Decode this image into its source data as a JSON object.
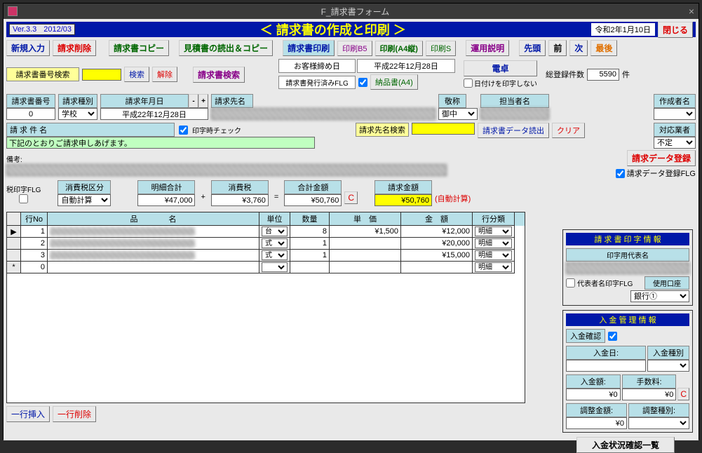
{
  "win": {
    "title": "F_請求書フォーム",
    "ver": "Ver.3.3",
    "verdate": "2012/03",
    "headerTitle": "＜ 請求書の作成と印刷 ＞",
    "today": "令和2年1月10日",
    "close": "閉じる"
  },
  "tb1": {
    "new": "新規入力",
    "del": "請求削除",
    "copy": "請求書コピー",
    "readest": "見積書の読出＆コピー",
    "print": "請求書印刷",
    "b5": "印刷B5",
    "a4p": "印刷(A4縦)",
    "s": "印刷S",
    "help": "運用説明",
    "first": "先頭",
    "prev": "前",
    "next": "次",
    "last": "最後"
  },
  "tb2": {
    "searchlbl": "請求書番号検索",
    "searchbtn": "検索",
    "clr": "解除",
    "invsearch": "請求書検索",
    "duelbl": "お客様締め日",
    "dueval": "平成22年12月28日",
    "issuedlbl": "請求書発行済みFLG",
    "delivbtn": "納品書(A4)",
    "calc": "電卓",
    "totallbl": "総登録件数",
    "totalval": "5590",
    "unit": "件",
    "noprintdate": "日付けを印字しない"
  },
  "inv": {
    "nolbl": "請求書番号",
    "no": "0",
    "typelbl": "請求種別",
    "type": "学校",
    "datelbl": "請求年月日",
    "date": "平成22年12月28日",
    "addrlbl": "請求先名",
    "honlbl": "敬称",
    "hon": "御中",
    "piclbl": "担当者名",
    "authorlbl": "作成者名"
  },
  "subj": {
    "lbl": "請 求 件 名",
    "body": "下記のとおりご請求申しあげます。",
    "chkprint": "印字時チェック",
    "addrsearch": "請求先名検索",
    "dataout": "請求書データ読出",
    "clear": "クリア",
    "vendorlbl": "対応業者",
    "vendor": "不定"
  },
  "remark": {
    "lbl": "備考:"
  },
  "reg": {
    "btn": "請求データ登録",
    "flg": "請求データ登録FLG"
  },
  "sums": {
    "taxflg": "税印字FLG",
    "taxcls": "消費税区分",
    "taxclsval": "自動計算",
    "subtotallbl": "明細合計",
    "subtotal": "¥47,000",
    "taxlbl": "消費税",
    "tax": "¥3,760",
    "totallbl": "合計金額",
    "total": "¥50,760",
    "billlbl": "請求金額",
    "bill": "¥50,760",
    "auto": "(自動計算)",
    "cbtn": "C"
  },
  "cols": {
    "no": "行No",
    "name": "品　　　　名",
    "unit": "単位",
    "qty": "数量",
    "price": "単　価",
    "amt": "金　額",
    "cat": "行分類"
  },
  "rows": [
    {
      "no": "1",
      "unit": "台",
      "qty": "8",
      "price": "¥1,500",
      "amt": "¥12,000",
      "cat": "明細"
    },
    {
      "no": "2",
      "unit": "式",
      "qty": "1",
      "price": "",
      "amt": "¥20,000",
      "cat": "明細"
    },
    {
      "no": "3",
      "unit": "式",
      "qty": "1",
      "price": "",
      "amt": "¥15,000",
      "cat": "明細"
    },
    {
      "no": "0",
      "unit": "",
      "qty": "",
      "price": "",
      "amt": "",
      "cat": "明細"
    }
  ],
  "bottom": {
    "ins": "一行挿入",
    "del": "一行削除"
  },
  "printinfo": {
    "head": "請 求 書 印 字 情 報",
    "replbl": "印字用代表名",
    "repcb": "代表者名印字FLG",
    "acctlbl": "使用口座",
    "acct": "銀行①"
  },
  "payinfo": {
    "head": "入 金 管 理 情 報",
    "cfm": "入金確認",
    "datelbl": "入金日:",
    "typelbl": "入金種別",
    "amtlbl": "入金額:",
    "amt": "¥0",
    "feelbl": "手数料:",
    "fee": "¥0",
    "adjlbl": "調整金額:",
    "adj": "¥0",
    "adjtypelbl": "調整種別:",
    "listbtn": "入金状況確認一覧",
    "cbtn": "C"
  }
}
